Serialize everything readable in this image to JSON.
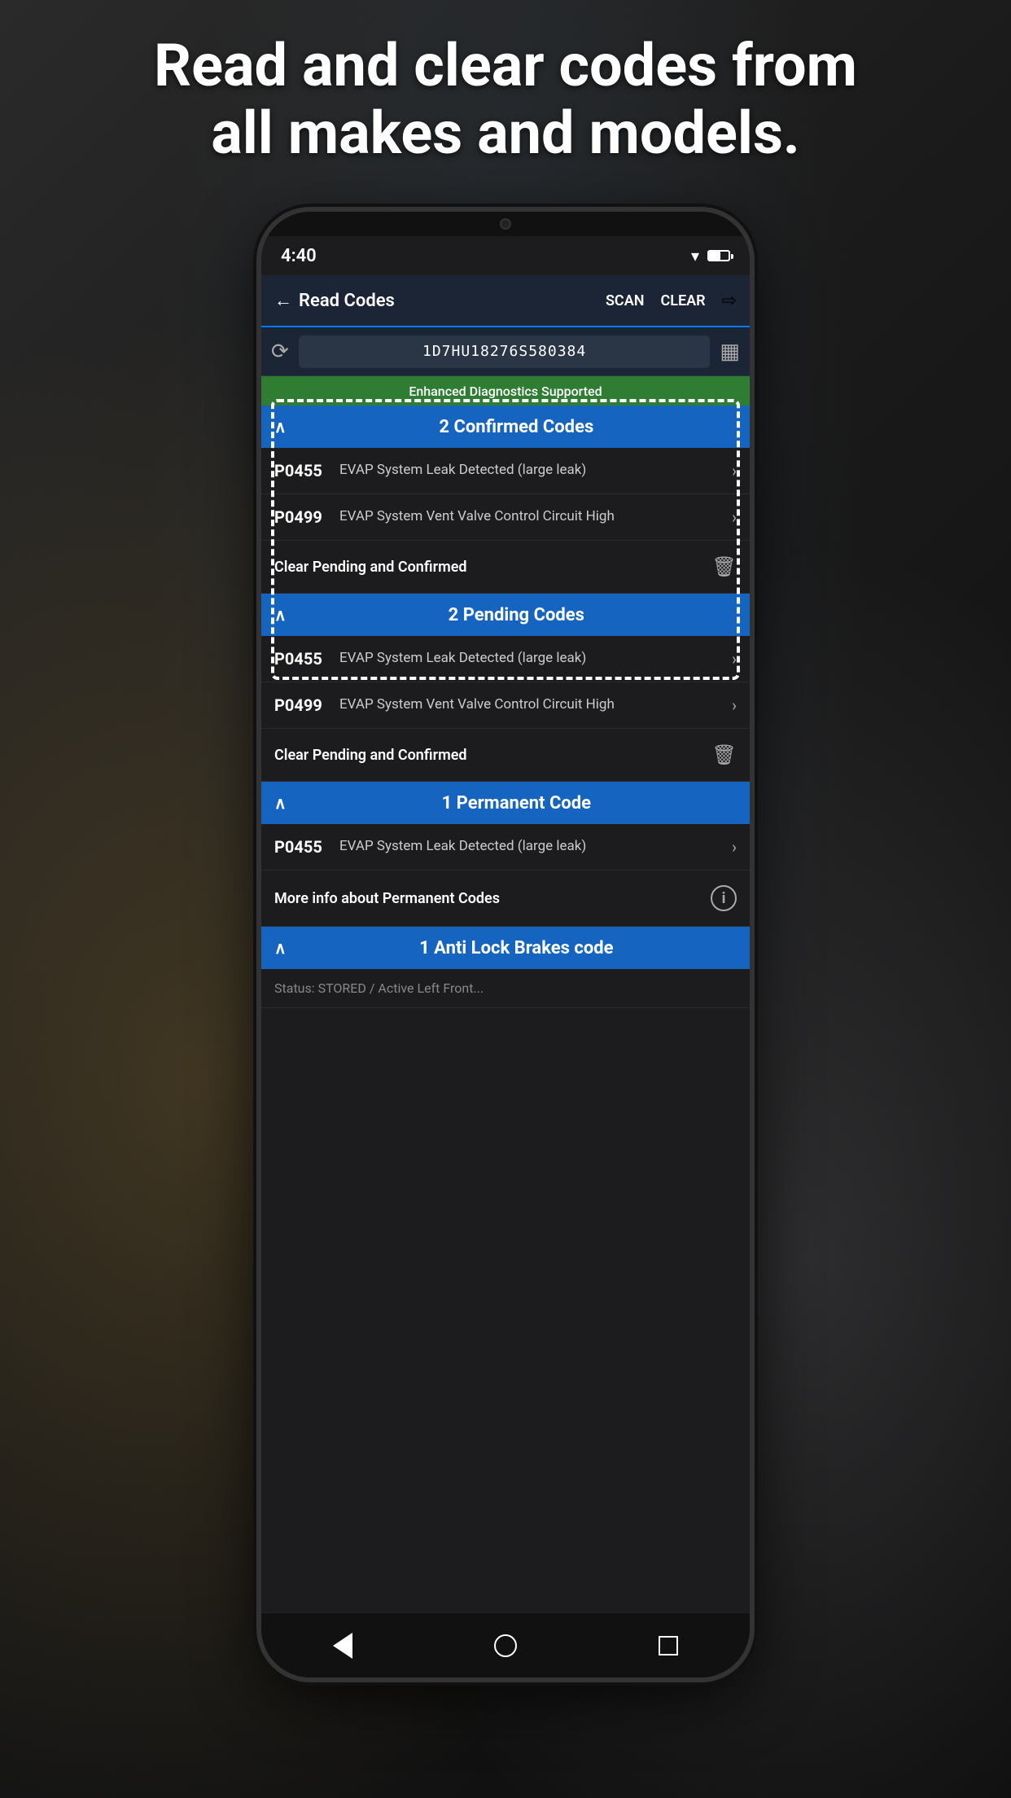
{
  "headline": {
    "line1": "Read and clear codes from",
    "line2": "all makes and models."
  },
  "status_bar": {
    "time": "4:40",
    "wifi": "wifi",
    "battery": "battery"
  },
  "header": {
    "back_label": "Read Codes",
    "scan_label": "SCAN",
    "clear_label": "CLEAR",
    "share_icon": "share"
  },
  "vin_bar": {
    "history_icon": "history",
    "vin_number": "1D7HU18276S580384",
    "barcode_icon": "barcode"
  },
  "enhanced_banner": {
    "text": "Enhanced Diagnostics Supported"
  },
  "sections": [
    {
      "id": "confirmed",
      "title": "2 Confirmed Codes",
      "codes": [
        {
          "id": "P0455",
          "description": "EVAP System Leak Detected (large leak)"
        },
        {
          "id": "P0499",
          "description": "EVAP System Vent Valve Control Circuit High"
        }
      ],
      "clear_label": "Clear Pending and Confirmed",
      "clear_icon": "trash"
    },
    {
      "id": "pending",
      "title": "2 Pending Codes",
      "codes": [
        {
          "id": "P0455",
          "description": "EVAP System Leak Detected (large leak)"
        },
        {
          "id": "P0499",
          "description": "EVAP System Vent Valve Control Circuit High"
        }
      ],
      "clear_label": "Clear Pending and Confirmed",
      "clear_icon": "trash"
    },
    {
      "id": "permanent",
      "title": "1 Permanent Code",
      "codes": [
        {
          "id": "P0455",
          "description": "EVAP System Leak Detected (large leak)"
        }
      ],
      "info_label": "More info about Permanent Codes",
      "info_icon": "info"
    },
    {
      "id": "abs",
      "title": "1 Anti Lock Brakes code",
      "codes": [],
      "partial_text": "Status: STORED / Active Left Front..."
    }
  ],
  "nav": {
    "back_icon": "back-triangle",
    "home_icon": "home-circle",
    "recents_icon": "recents-square"
  }
}
